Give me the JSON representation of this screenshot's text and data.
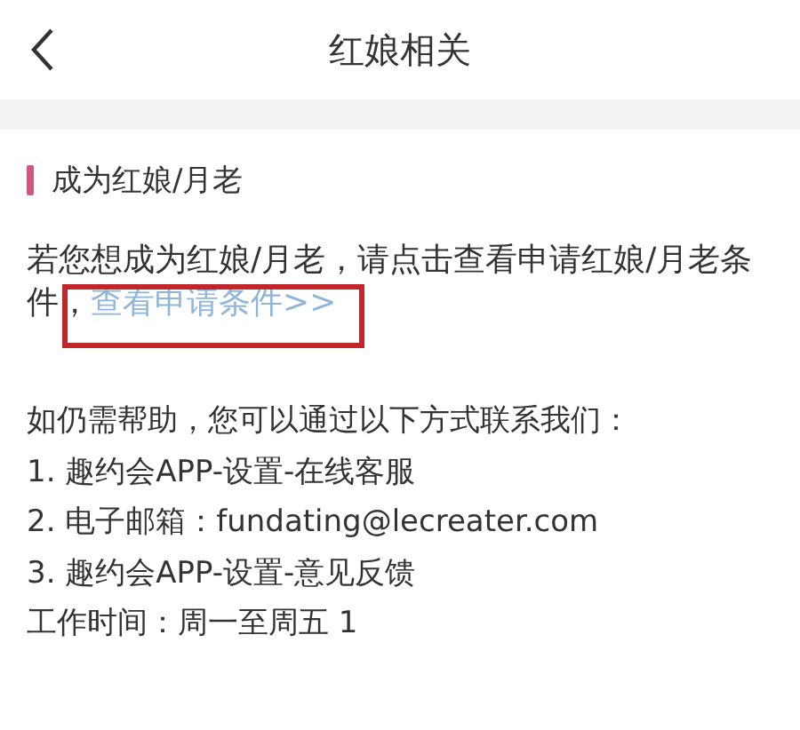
{
  "header": {
    "title": "红娘相关"
  },
  "section": {
    "title": "成为红娘/月老"
  },
  "notice": {
    "text": "若您想成为红娘/月老，请点击查看申请红娘/月老条件，",
    "link": "查看申请条件>>",
    "highlighted": true
  },
  "help": {
    "intro": "如仍需帮助，您可以通过以下方式联系我们：",
    "items": [
      "1. 趣约会APP-设置-在线客服",
      "2. 电子邮箱：fundating@lecreater.com",
      "3. 趣约会APP-设置-意见反馈"
    ],
    "hours": "工作时间：周一至周五 1"
  }
}
